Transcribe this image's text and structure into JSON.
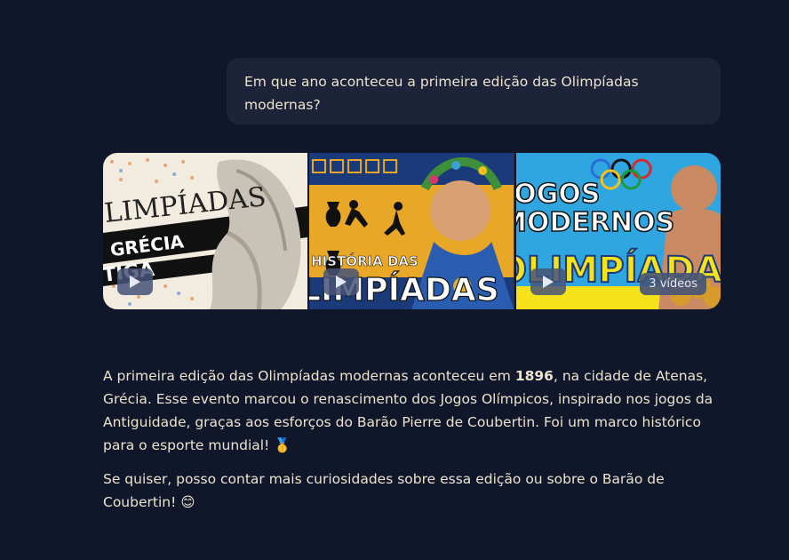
{
  "question": "Em que ano aconteceu a primeira edição das Olimpíadas modernas?",
  "videos": {
    "count_label": "3 vídeos",
    "items": [
      {
        "title_lines": [
          "LIMPÍADAS",
          "GRÉCIA",
          "TIGA"
        ],
        "colors": {
          "bg": "#f1ebe0",
          "band": "#111111",
          "statue": "#c9c2b6"
        }
      },
      {
        "title_lines": [
          "HISTÓRIA DAS",
          "LIMPÍADAS"
        ],
        "colors": {
          "bg": "#e8a726",
          "border": "#1b3a7a",
          "face": "#d9a074"
        }
      },
      {
        "title_lines": [
          "JOGOS",
          "MODERNOS",
          "OLIMPÍADAS !"
        ],
        "colors": {
          "bg": "#2fa6df",
          "text": "#f5e21b"
        }
      }
    ]
  },
  "answer": {
    "p1_part1": "A primeira edição das Olimpíadas modernas aconteceu em ",
    "p1_year": "1896",
    "p1_part2": ", na cidade de Atenas, Grécia. Esse evento marcou o renascimento dos Jogos Olímpicos, inspirado nos jogos da Antiguidade, graças aos esforços do Barão Pierre de Coubertin. Foi um marco histórico para o esporte mundial! 🥇",
    "p2": "Se quiser, posso contar mais curiosidades sobre essa edição ou sobre o Barão de Coubertin! 😊"
  }
}
